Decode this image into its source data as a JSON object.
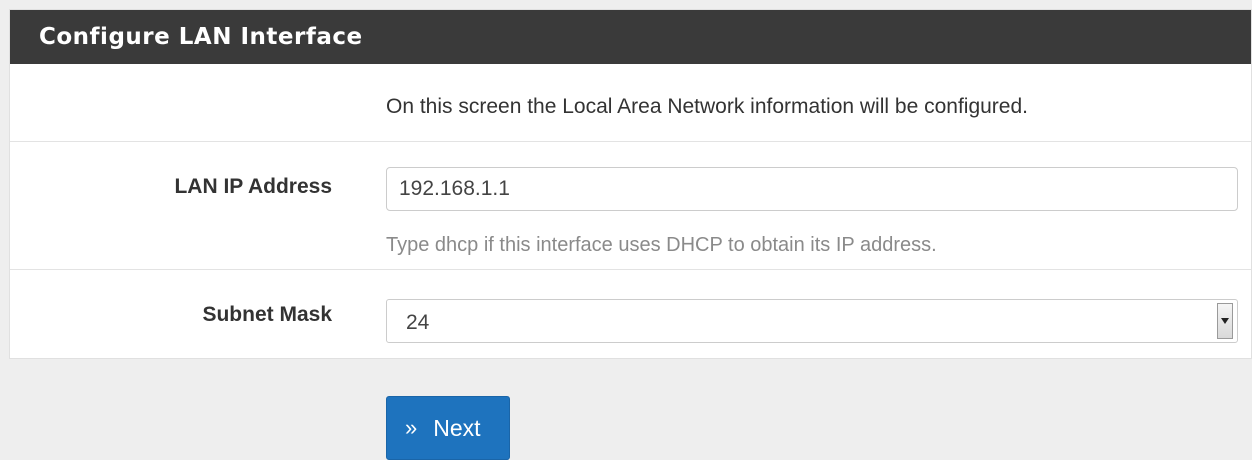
{
  "panel": {
    "title": "Configure LAN Interface",
    "intro": "On this screen the Local Area Network information will be configured."
  },
  "lan_ip": {
    "label": "LAN IP Address",
    "value": "192.168.1.1",
    "help": "Type dhcp if this interface uses DHCP to obtain its IP address."
  },
  "subnet": {
    "label": "Subnet Mask",
    "value": "24"
  },
  "next_button": {
    "icon": "double-chevron-right-icon",
    "label": "Next"
  }
}
